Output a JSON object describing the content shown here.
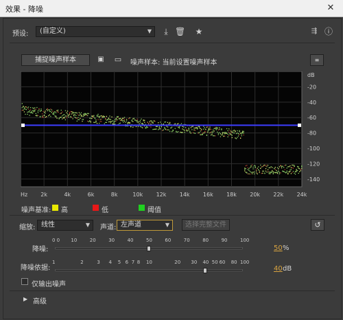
{
  "window": {
    "title": "效果 - 降噪",
    "close_glyph": "✕"
  },
  "preset": {
    "label": "预设:",
    "value": "(自定义)"
  },
  "capture": {
    "button_label": "捕捉噪声样本",
    "status": "噪声样本: 当前设置噪声样本"
  },
  "graph": {
    "y_unit": "dB",
    "y_ticks": [
      "-20",
      "-40",
      "-60",
      "-80",
      "-100",
      "-120",
      "-140"
    ],
    "x_ticks": [
      "Hz",
      "2k",
      "4k",
      "6k",
      "8k",
      "10k",
      "12k",
      "14k",
      "16k",
      "18k",
      "20k",
      "22k",
      "24k"
    ],
    "threshold_db": -70
  },
  "legend": {
    "label": "噪声基准:",
    "items": [
      {
        "label": "高",
        "color": "#e8e800"
      },
      {
        "label": "低",
        "color": "#e81818"
      },
      {
        "label": "阈值",
        "color": "#20d020"
      }
    ]
  },
  "scale": {
    "label": "缩放:",
    "value": "线性"
  },
  "channel": {
    "label": "声道:",
    "value": "左声道"
  },
  "select_file_button": "选择完整文件",
  "noise_reduction": {
    "label": "降噪:",
    "ticks": [
      "0 0",
      "10",
      "20",
      "30",
      "40",
      "50",
      "60",
      "70",
      "80",
      "90",
      "100"
    ],
    "value": "50",
    "unit": "%"
  },
  "reduce_by": {
    "label": "降噪依据:",
    "ticks": [
      "1",
      "2",
      "3",
      "4",
      "5",
      "6",
      "7",
      "8",
      "10",
      "20",
      "30",
      "40",
      "50",
      "60",
      "80",
      "100"
    ],
    "value": "40",
    "unit": "dB"
  },
  "output_noise_only": {
    "label": "仅输出噪声"
  },
  "advanced": {
    "label": "高级"
  }
}
